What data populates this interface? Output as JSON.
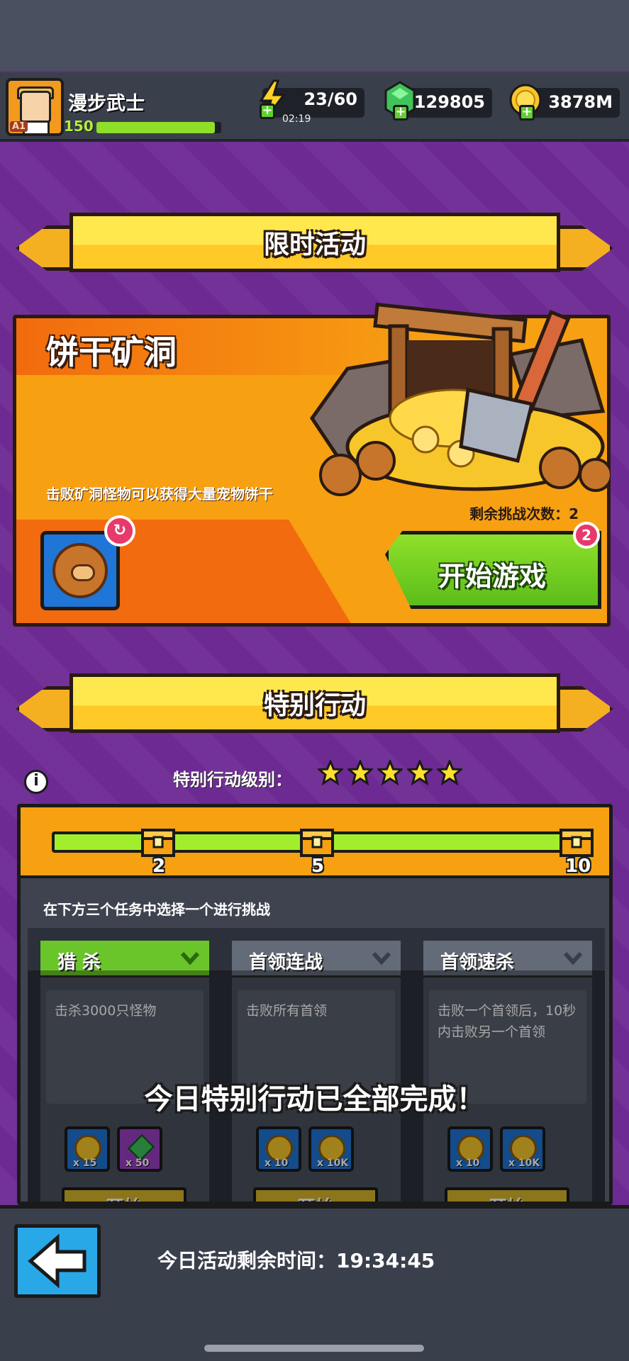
{
  "player": {
    "name": "漫步武士",
    "level": "150",
    "rank_badge": "A1",
    "xp_fraction": 0.95
  },
  "resources": {
    "energy": "23/60",
    "energy_timer": "02:19",
    "gems": "129805",
    "coins": "3878M"
  },
  "limited_event": {
    "section_title": "限时活动",
    "event_name": "饼干矿洞",
    "description": "击败矿洞怪物可以获得大量宠物饼干",
    "remaining_tries": "剩余挑战次数：2",
    "start_button": "开始游戏",
    "start_badge": "2"
  },
  "special_ops": {
    "section_title": "特别行动",
    "level_label": "特别行动级别：",
    "stars": 5,
    "progress_fraction": 1.0,
    "milestones": [
      "2",
      "5",
      "10"
    ],
    "instruction": "在下方三个任务中选择一个进行挑战",
    "tasks": [
      {
        "title": "猎 杀",
        "description": "击杀3000只怪物",
        "rewards": [
          {
            "type": "coin",
            "qty": "x 15"
          },
          {
            "type": "gem",
            "qty": "x 50"
          }
        ],
        "button": "开始"
      },
      {
        "title": "首领连战",
        "description": "击败所有首领",
        "rewards": [
          {
            "type": "coin",
            "qty": "x 10"
          },
          {
            "type": "coin",
            "qty": "x 10K"
          }
        ],
        "button": "开始"
      },
      {
        "title": "首领速杀",
        "description": "击败一个首领后，10秒内击败另一个首领",
        "rewards": [
          {
            "type": "coin",
            "qty": "x 10"
          },
          {
            "type": "coin",
            "qty": "x 10K"
          }
        ],
        "button": "开始"
      }
    ],
    "completed_message": "今日特别行动已全部完成！"
  },
  "footer": {
    "remaining_time_label": "今日活动剩余时间：19:34:45"
  },
  "colors": {
    "background": "#6d2a93",
    "accent_orange": "#f7a012",
    "accent_green": "#8fe02a",
    "banner_yellow": "#ffe84e"
  }
}
